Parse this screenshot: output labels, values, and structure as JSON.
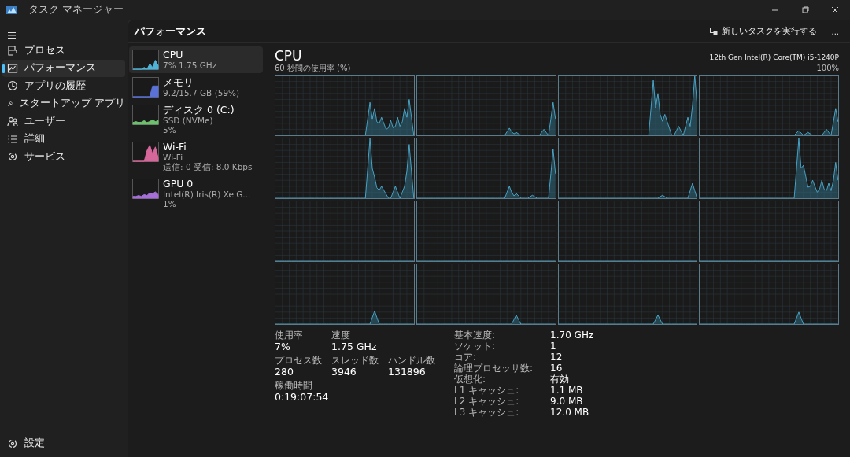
{
  "window": {
    "title": "タスク マネージャー"
  },
  "nav": {
    "items": [
      {
        "kind": "processes",
        "label": "プロセス",
        "selected": false
      },
      {
        "kind": "performance",
        "label": "パフォーマンス",
        "selected": true
      },
      {
        "kind": "history",
        "label": "アプリの履歴",
        "selected": false
      },
      {
        "kind": "startup",
        "label": "スタートアップ アプリ",
        "selected": false
      },
      {
        "kind": "users",
        "label": "ユーザー",
        "selected": false
      },
      {
        "kind": "details",
        "label": "詳細",
        "selected": false
      },
      {
        "kind": "services",
        "label": "サービス",
        "selected": false
      }
    ],
    "settings": "設定"
  },
  "header": {
    "title": "パフォーマンス",
    "run_task": "新しいタスクを実行する",
    "more": "..."
  },
  "devices": [
    {
      "name": "CPU",
      "lines": [
        "7% 1.75 GHz"
      ],
      "color": "#4fb3d9",
      "selected": true
    },
    {
      "name": "メモリ",
      "lines": [
        "9.2/15.7 GB (59%)"
      ],
      "color": "#5a72d8",
      "selected": false
    },
    {
      "name": "ディスク 0 (C:)",
      "lines": [
        "SSD (NVMe)",
        "5%"
      ],
      "color": "#6fbf6f",
      "selected": false
    },
    {
      "name": "Wi-Fi",
      "lines": [
        "Wi-Fi",
        "送信: 0 受信: 8.0 Kbps"
      ],
      "color": "#d6679a",
      "selected": false
    },
    {
      "name": "GPU 0",
      "lines": [
        "Intel(R) Iris(R) Xe G...",
        "1%"
      ],
      "color": "#a46fd6",
      "selected": false
    }
  ],
  "cpu": {
    "title": "CPU",
    "model": "12th Gen Intel(R) Core(TM) i5-1240P",
    "graph_caption": "60 秒間の使用率 (%)",
    "graph_max": "100%",
    "stats": [
      {
        "label": "使用率",
        "value": "7%"
      },
      {
        "label": "速度",
        "value": "1.75 GHz"
      },
      {
        "label": "プロセス数",
        "value": "280"
      },
      {
        "label": "スレッド数",
        "value": "3946"
      },
      {
        "label": "ハンドル数",
        "value": "131896"
      },
      {
        "label": "稼働時間",
        "value": "0:19:07:54"
      }
    ],
    "specs": [
      {
        "label": "基本速度:",
        "value": "1.70 GHz"
      },
      {
        "label": "ソケット:",
        "value": "1"
      },
      {
        "label": "コア:",
        "value": "12"
      },
      {
        "label": "論理プロセッサ数:",
        "value": "16"
      },
      {
        "label": "仮想化:",
        "value": "有効"
      },
      {
        "label": "L1 キャッシュ:",
        "value": "1.1 MB"
      },
      {
        "label": "L2 キャッシュ:",
        "value": "9.0 MB"
      },
      {
        "label": "L3 キャッシュ:",
        "value": "12.0 MB"
      }
    ]
  }
}
